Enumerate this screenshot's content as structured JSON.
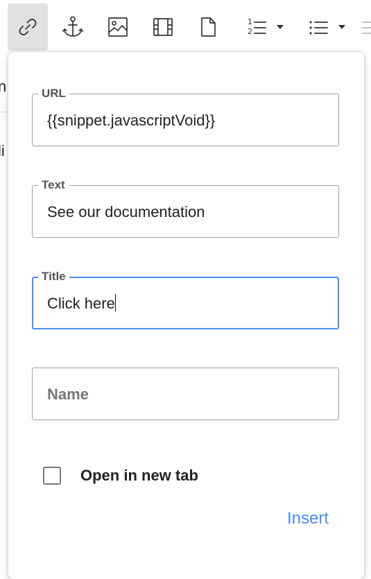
{
  "toolbar": {
    "buttons": [
      {
        "icon": "link-icon",
        "active": true
      },
      {
        "icon": "anchor-icon"
      },
      {
        "icon": "image-icon"
      },
      {
        "icon": "film-icon"
      },
      {
        "icon": "file-icon"
      },
      {
        "icon": "ordered-list-icon",
        "dropdown": true
      },
      {
        "icon": "bullet-list-icon",
        "dropdown": true
      }
    ]
  },
  "background": {
    "peek_line_1": "n",
    "peek_line_2": "li"
  },
  "link_dialog": {
    "url": {
      "label": "URL",
      "value": "{{snippet.javascriptVoid}}"
    },
    "text": {
      "label": "Text",
      "value": "See our documentation"
    },
    "title": {
      "label": "Title",
      "value": "Click here"
    },
    "name": {
      "placeholder": "Name",
      "value": ""
    },
    "open_new_tab": {
      "label": "Open in new tab",
      "checked": false
    },
    "insert_label": "Insert"
  },
  "colors": {
    "accent": "#4a8af4",
    "border": "#9e9e9e",
    "active_button_bg": "#e1e1e1"
  }
}
